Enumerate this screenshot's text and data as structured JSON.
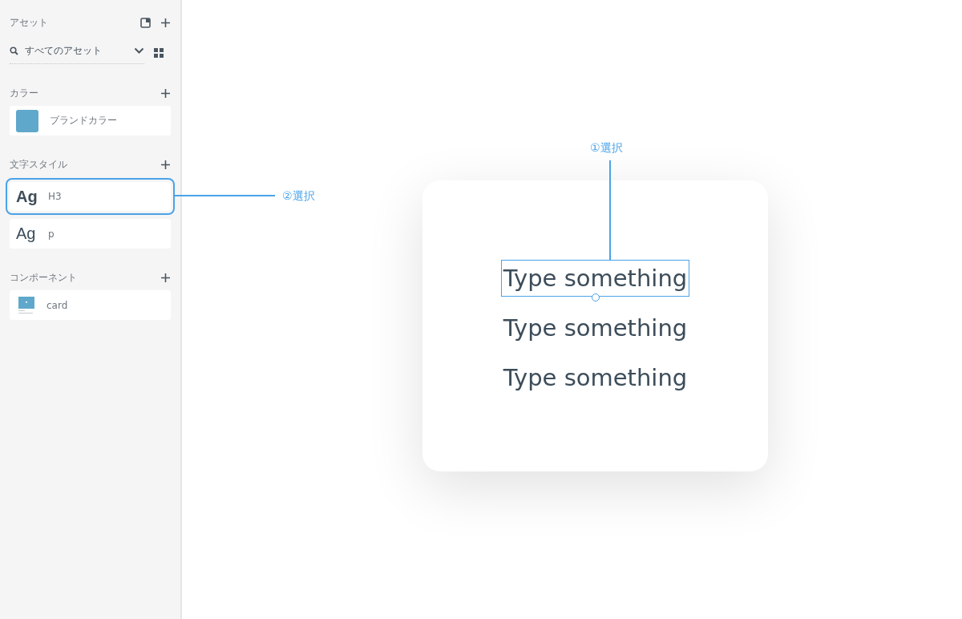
{
  "sidebar": {
    "title": "アセット",
    "search": {
      "placeholder": "すべてのアセット"
    },
    "sections": [
      {
        "title": "カラー",
        "kind": "color",
        "items": [
          {
            "label": "ブランドカラー",
            "color": "#5fa8cb",
            "selected": false
          }
        ]
      },
      {
        "title": "文字スタイル",
        "kind": "text",
        "items": [
          {
            "sample": "Ag",
            "label": "H3",
            "bold": true,
            "selected": true
          },
          {
            "sample": "Ag",
            "label": "p",
            "bold": false,
            "selected": false
          }
        ]
      },
      {
        "title": "コンポーネント",
        "kind": "component",
        "items": [
          {
            "label": "card",
            "selected": false
          }
        ]
      }
    ]
  },
  "artboard": {
    "texts": [
      {
        "text": "Type something",
        "selected": true
      },
      {
        "text": "Type something",
        "selected": false
      },
      {
        "text": "Type something",
        "selected": false
      }
    ]
  },
  "annotations": [
    {
      "text": "①選択",
      "kind": "vertical"
    },
    {
      "text": "②選択",
      "kind": "horizontal"
    }
  ]
}
